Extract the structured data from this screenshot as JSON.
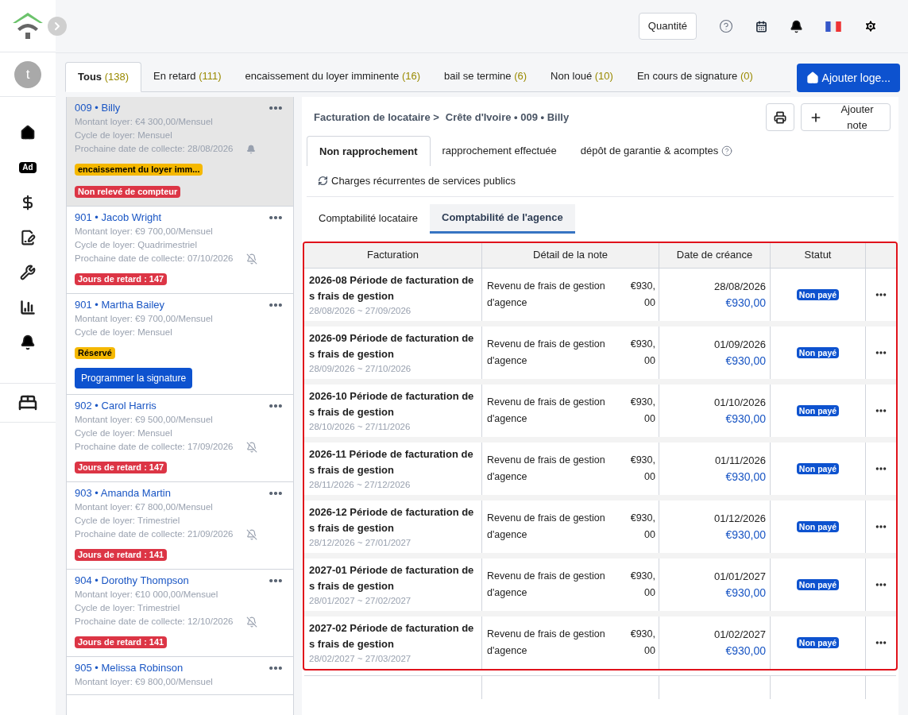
{
  "header": {
    "quantity_button": "Quantité"
  },
  "sidebar": {
    "avatar": "t",
    "items": [
      {
        "kind": "home"
      },
      {
        "kind": "ad",
        "text": "Ad"
      },
      {
        "kind": "dollar"
      },
      {
        "kind": "sign"
      },
      {
        "kind": "wrench"
      },
      {
        "kind": "chart"
      },
      {
        "kind": "bell"
      }
    ],
    "bottom_items": [
      {
        "kind": "bed"
      }
    ]
  },
  "tabs": [
    {
      "label": "Tous",
      "count": "(138)",
      "selected": true
    },
    {
      "label": "En retard",
      "count": "(111)",
      "selected": false
    },
    {
      "label": "encaissement du loyer imminente",
      "count": "(16)",
      "selected": false
    },
    {
      "label": "bail se termine",
      "count": "(6)",
      "selected": false
    },
    {
      "label": "Non loué",
      "count": "(10)",
      "selected": false
    },
    {
      "label": "En cours de signature",
      "count": "(0)",
      "selected": false
    }
  ],
  "add_button": "Ajouter loge...",
  "units": [
    {
      "unit": "009",
      "sep": "•",
      "name": "Billy",
      "selected": true,
      "lines": [
        "Montant loyer: €4 300,00/Mensuel",
        "Cycle de loyer: Mensuel"
      ],
      "date_label": "Prochaine date de collecte:",
      "date": "28/08/2026",
      "reminder": true,
      "badges": [
        {
          "kind": "warning",
          "text": "encaissement du loyer imm..."
        },
        {
          "kind": "danger",
          "text": "Non relevé de compteur"
        }
      ]
    },
    {
      "unit": "901",
      "sep": "•",
      "name": "Jacob Wright",
      "selected": false,
      "lines": [
        "Montant loyer: €9 700,00/Mensuel",
        "Cycle de loyer: Quadrimestriel"
      ],
      "date_label": "Prochaine date de collecte:",
      "date": "07/10/2026",
      "reminder": false,
      "badges": [
        {
          "kind": "danger",
          "text": "Jours de retard : 147"
        }
      ]
    },
    {
      "unit": "901",
      "sep": "•",
      "name": "Martha Bailey",
      "selected": false,
      "lines": [
        "Montant loyer: €9 700,00/Mensuel",
        "Cycle de loyer: Mensuel"
      ],
      "badges": [
        {
          "kind": "warning",
          "text": "Réservé"
        }
      ],
      "action": "Programmer la signature"
    },
    {
      "unit": "902",
      "sep": "•",
      "name": "Carol Harris",
      "selected": false,
      "lines": [
        "Montant loyer: €9 500,00/Mensuel",
        "Cycle de loyer: Mensuel"
      ],
      "date_label": "Prochaine date de collecte:",
      "date": "17/09/2026",
      "reminder": false,
      "badges": [
        {
          "kind": "danger",
          "text": "Jours de retard : 147"
        }
      ]
    },
    {
      "unit": "903",
      "sep": "•",
      "name": "Amanda Martin",
      "selected": false,
      "lines": [
        "Montant loyer: €7 800,00/Mensuel",
        "Cycle de loyer: Trimestriel"
      ],
      "date_label": "Prochaine date de collecte:",
      "date": "21/09/2026",
      "reminder": false,
      "badges": [
        {
          "kind": "danger",
          "text": "Jours de retard : 141"
        }
      ]
    },
    {
      "unit": "904",
      "sep": "•",
      "name": "Dorothy Thompson",
      "selected": false,
      "lines": [
        "Montant loyer: €10 000,00/Mensuel",
        "Cycle de loyer: Trimestriel"
      ],
      "date_label": "Prochaine date de collecte:",
      "date": "12/10/2026",
      "reminder": false,
      "badges": [
        {
          "kind": "danger",
          "text": "Jours de retard : 141"
        }
      ]
    },
    {
      "unit": "905",
      "sep": "•",
      "name": "Melissa Robinson",
      "selected": false,
      "lines": [
        "Montant loyer: €9 800,00/Mensuel"
      ]
    }
  ],
  "detail": {
    "breadcrumb": [
      "Facturation de locataire >",
      "Crête d'Ivoire • 009 • Billy"
    ],
    "note_button": "Ajouter note",
    "tabs": [
      {
        "label": "Non rapprochement",
        "selected": true
      },
      {
        "label": "rapprochement effectuée",
        "selected": false
      },
      {
        "label": "dépôt de garantie & acomptes",
        "selected": false,
        "help": true
      }
    ],
    "recurring_link": "Charges récurrentes de services publics",
    "subtabs": [
      {
        "label": "Comptabilité locataire",
        "selected": false
      },
      {
        "label": "Comptabilité de l'agence",
        "selected": true
      }
    ],
    "table": {
      "columns": [
        "Facturation",
        "Détail de la note",
        "Date de créance",
        "Statut"
      ],
      "rows": [
        {
          "title": "2026-08 Période de facturation des frais de gestion",
          "period": "28/08/2026 ~ 27/09/2026",
          "detail": "Revenu de frais de gestion d'agence",
          "amount": "€930,00",
          "date": "28/08/2026",
          "total": "€930,00",
          "status": "Non payé"
        },
        {
          "title": "2026-09 Période de facturation des frais de gestion",
          "period": "28/09/2026 ~ 27/10/2026",
          "detail": "Revenu de frais de gestion d'agence",
          "amount": "€930,00",
          "date": "01/09/2026",
          "total": "€930,00",
          "status": "Non payé"
        },
        {
          "title": "2026-10 Période de facturation des frais de gestion",
          "period": "28/10/2026 ~ 27/11/2026",
          "detail": "Revenu de frais de gestion d'agence",
          "amount": "€930,00",
          "date": "01/10/2026",
          "total": "€930,00",
          "status": "Non payé"
        },
        {
          "title": "2026-11 Période de facturation des frais de gestion",
          "period": "28/11/2026 ~ 27/12/2026",
          "detail": "Revenu de frais de gestion d'agence",
          "amount": "€930,00",
          "date": "01/11/2026",
          "total": "€930,00",
          "status": "Non payé"
        },
        {
          "title": "2026-12 Période de facturation des frais de gestion",
          "period": "28/12/2026 ~ 27/01/2027",
          "detail": "Revenu de frais de gestion d'agence",
          "amount": "€930,00",
          "date": "01/12/2026",
          "total": "€930,00",
          "status": "Non payé"
        },
        {
          "title": "2027-01 Période de facturation des frais de gestion",
          "period": "28/01/2027 ~ 27/02/2027",
          "detail": "Revenu de frais de gestion d'agence",
          "amount": "€930,00",
          "date": "01/01/2027",
          "total": "€930,00",
          "status": "Non payé"
        },
        {
          "title": "2027-02 Période de facturation des frais de gestion",
          "period": "28/02/2027 ~ 27/03/2027",
          "detail": "Revenu de frais de gestion d'agence",
          "amount": "€930,00",
          "date": "01/02/2027",
          "total": "€930,00",
          "status": "Non payé"
        }
      ]
    }
  }
}
